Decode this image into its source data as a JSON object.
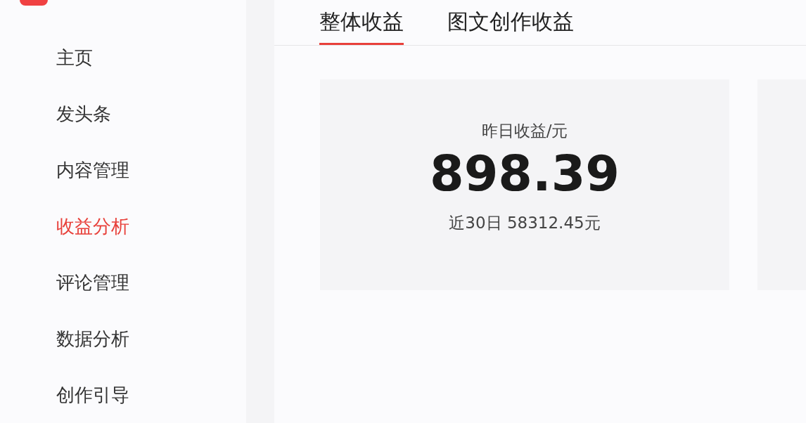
{
  "sidebar": {
    "items": [
      {
        "label": "主页",
        "selected": false
      },
      {
        "label": "发头条",
        "selected": false
      },
      {
        "label": "内容管理",
        "selected": false
      },
      {
        "label": "收益分析",
        "selected": true
      },
      {
        "label": "评论管理",
        "selected": false
      },
      {
        "label": "数据分析",
        "selected": false
      },
      {
        "label": "创作引导",
        "selected": false
      }
    ]
  },
  "tabs": [
    {
      "label": "整体收益",
      "selected": true
    },
    {
      "label": "图文创作收益",
      "selected": false
    }
  ],
  "summary_card": {
    "label": "昨日收益/元",
    "value": "898.39",
    "recent": "近30日 58312.45元"
  }
}
